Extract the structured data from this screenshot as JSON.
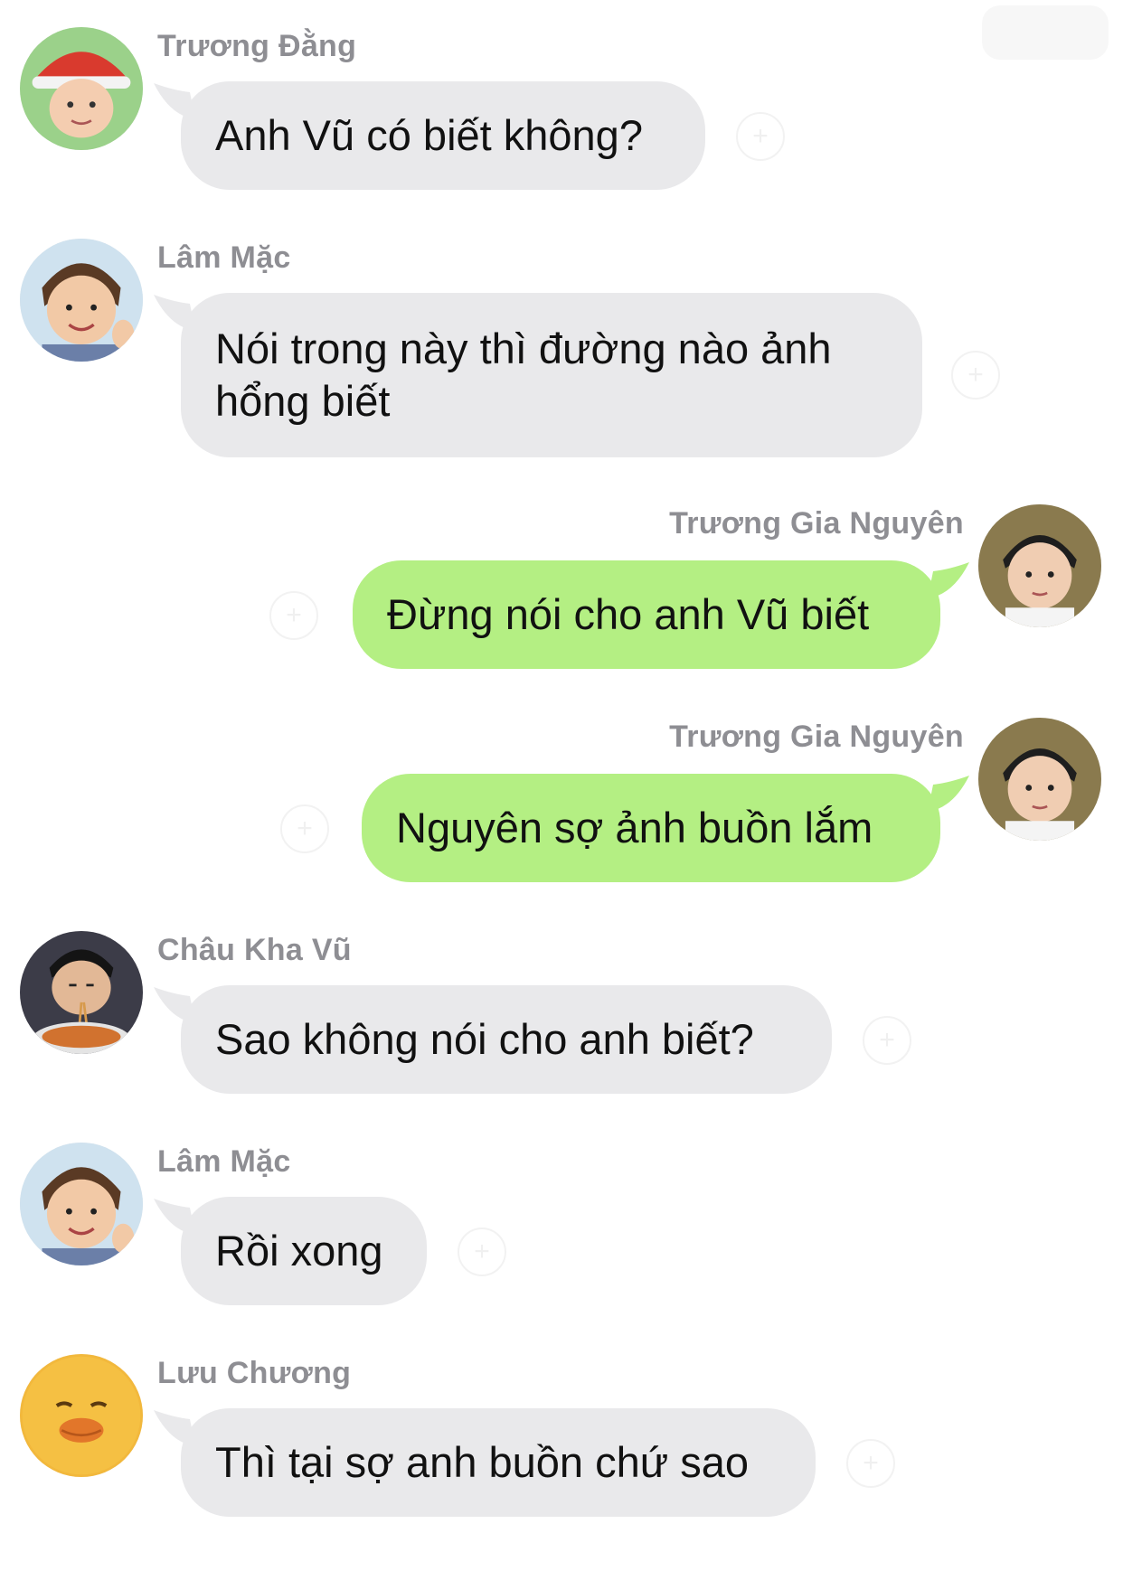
{
  "messages": [
    {
      "sender": "Trương Đằng",
      "text": "Anh Vũ có biết không?",
      "avatar": "santa-hat-child-avatar"
    },
    {
      "sender": "Lâm Mặc",
      "text": "Nói trong này thì đường nào ảnh hổng biết",
      "avatar": "waving-child-avatar"
    },
    {
      "sender": "Trương Gia Nguyên",
      "text": "Đừng nói cho anh Vũ biết",
      "avatar": "child-portrait-avatar"
    },
    {
      "sender": "Trương Gia Nguyên",
      "text": "Nguyên sợ ảnh buồn lắm",
      "avatar": "child-portrait-avatar"
    },
    {
      "sender": "Châu Kha Vũ",
      "text": "Sao không nói cho anh biết?",
      "avatar": "noodle-eating-child-avatar"
    },
    {
      "sender": "Lâm Mặc",
      "text": "Rồi xong",
      "avatar": "waving-child-avatar"
    },
    {
      "sender": "Lưu Chương",
      "text": "Thì tại sợ anh buồn chứ sao",
      "avatar": "yellow-duck-avatar"
    }
  ],
  "colors": {
    "incoming_bubble": "#e9e9eb",
    "outgoing_bubble": "#b4ef83",
    "sender_name": "#8e8e93",
    "background": "#ffffff"
  }
}
